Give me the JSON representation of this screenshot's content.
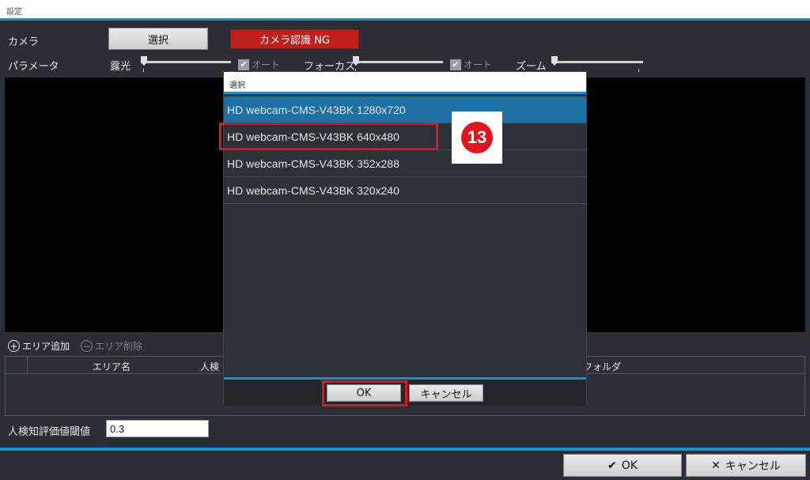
{
  "window": {
    "title": "設定"
  },
  "camera": {
    "label": "カメラ",
    "select_button": "選択",
    "status_badge": "カメラ認識 NG",
    "status_color": "#c0201c"
  },
  "params": {
    "label": "パラメータ",
    "exposure": {
      "label": "露光",
      "auto_label": "オート",
      "auto_checked": true
    },
    "focus": {
      "label": "フォーカス",
      "auto_label": "オート",
      "auto_checked": true
    },
    "zoom": {
      "label": "ズーム"
    }
  },
  "area": {
    "add_label": "エリア追加",
    "remove_label": "エリア削除",
    "columns": [
      "エリア名",
      "人検",
      "フォルダ"
    ]
  },
  "threshold": {
    "label": "人検知評価値閾値",
    "value": "0.3"
  },
  "footer": {
    "ok_label": "OK",
    "cancel_label": "キャンセル"
  },
  "dialog": {
    "title": "選択",
    "items": [
      {
        "label": "HD webcam-CMS-V43BK  1280x720",
        "selected": true
      },
      {
        "label": "HD webcam-CMS-V43BK  640x480",
        "selected": false
      },
      {
        "label": "HD webcam-CMS-V43BK  352x288",
        "selected": false
      },
      {
        "label": "HD webcam-CMS-V43BK  320x240",
        "selected": false
      }
    ],
    "ok_label": "OK",
    "cancel_label": "キャンセル"
  },
  "annotation": {
    "step_number": "13",
    "color": "#e0141c"
  },
  "colors": {
    "accent": "#1a8fd1",
    "background": "#2b2f35",
    "selected_row": "#1e6fa4"
  }
}
